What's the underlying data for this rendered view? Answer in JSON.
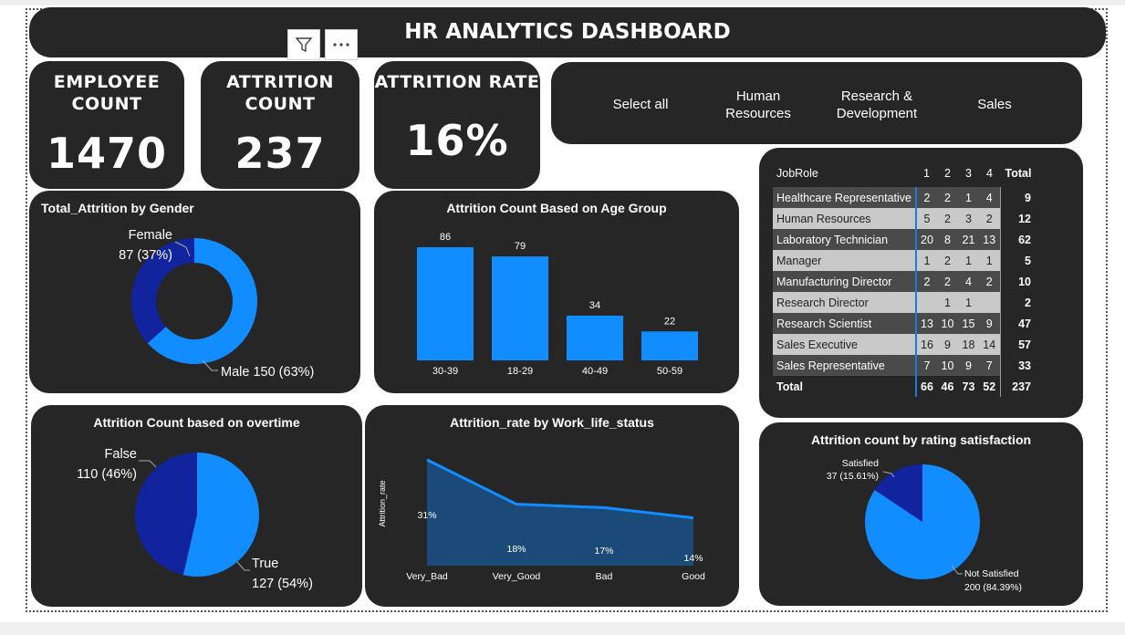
{
  "header": {
    "title": "HR ANALYTICS DASHBOARD"
  },
  "toolbar": {
    "filter_icon": "filter-icon",
    "more_icon": "more-options-icon"
  },
  "kpis": {
    "employee_count": {
      "title_line1": "EMPLOYEE",
      "title_line2": "COUNT",
      "value": "1470"
    },
    "attrition_count": {
      "title_line1": "ATTRITION",
      "title_line2": "COUNT",
      "value": "237"
    },
    "attrition_rate": {
      "title_line1": "ATTRITION RATE",
      "value": "16%"
    }
  },
  "slicer": {
    "items": [
      {
        "line1": "Select all",
        "line2": ""
      },
      {
        "line1": "Human",
        "line2": "Resources"
      },
      {
        "line1": "Research &",
        "line2": "Development"
      },
      {
        "line1": "Sales",
        "line2": ""
      }
    ]
  },
  "colors": {
    "card_bg": "#262626",
    "accent": "#118dff",
    "dark_blue": "#12239e",
    "area_fill": "#1b4a78"
  },
  "chart_data": [
    {
      "id": "gender",
      "type": "pie",
      "title": "Total_Attrition by Gender",
      "donut": true,
      "slices": [
        {
          "label": "Female",
          "value": 87,
          "display": "87 (37%)",
          "color": "#12239e"
        },
        {
          "label": "Male",
          "value": 150,
          "display": "Male 150 (63%)",
          "color": "#118dff"
        }
      ]
    },
    {
      "id": "age",
      "type": "bar",
      "title": "Attrition Count Based on Age Group",
      "categories": [
        "30-39",
        "18-29",
        "40-49",
        "50-59"
      ],
      "values": [
        86,
        79,
        34,
        22
      ],
      "ylim": [
        0,
        86
      ],
      "color": "#118dff"
    },
    {
      "id": "overtime",
      "type": "pie",
      "title": "Attrition Count based on overtime",
      "donut": false,
      "slices": [
        {
          "label": "False",
          "value": 110,
          "display": "110 (46%)",
          "color": "#12239e"
        },
        {
          "label": "True",
          "value": 127,
          "display": "127 (54%)",
          "color": "#118dff"
        }
      ]
    },
    {
      "id": "worklife",
      "type": "area",
      "title": "Attrition_rate by Work_life_status",
      "ylabel": "Attrition_rate",
      "categories": [
        "Very_Bad",
        "Very_Good",
        "Bad",
        "Good"
      ],
      "values": [
        31,
        18,
        17,
        14
      ],
      "labels": [
        "31%",
        "18%",
        "17%",
        "14%"
      ],
      "ylim": [
        0,
        31
      ]
    },
    {
      "id": "satisfaction",
      "type": "pie",
      "title": "Attrition count by rating satisfaction",
      "donut": false,
      "slices": [
        {
          "label": "Satisfied",
          "value": 37,
          "display": "37 (15.61%)",
          "color": "#12239e"
        },
        {
          "label": "Not Satisfied",
          "value": 200,
          "display": "200 (84.39%)",
          "color": "#118dff"
        }
      ]
    },
    {
      "id": "jobrole",
      "type": "table",
      "columns": [
        "JobRole",
        "1",
        "2",
        "3",
        "4",
        "Total"
      ],
      "rows": [
        {
          "role": "Healthcare Representative",
          "v": [
            "2",
            "2",
            "1",
            "4"
          ],
          "total": "9"
        },
        {
          "role": "Human Resources",
          "v": [
            "5",
            "2",
            "3",
            "2"
          ],
          "total": "12"
        },
        {
          "role": "Laboratory Technician",
          "v": [
            "20",
            "8",
            "21",
            "13"
          ],
          "total": "62"
        },
        {
          "role": "Manager",
          "v": [
            "1",
            "2",
            "1",
            "1"
          ],
          "total": "5"
        },
        {
          "role": "Manufacturing Director",
          "v": [
            "2",
            "2",
            "4",
            "2"
          ],
          "total": "10"
        },
        {
          "role": "Research Director",
          "v": [
            "",
            "1",
            "1",
            ""
          ],
          "total": "2"
        },
        {
          "role": "Research Scientist",
          "v": [
            "13",
            "10",
            "15",
            "9"
          ],
          "total": "47"
        },
        {
          "role": "Sales Executive",
          "v": [
            "16",
            "9",
            "18",
            "14"
          ],
          "total": "57"
        },
        {
          "role": "Sales Representative",
          "v": [
            "7",
            "10",
            "9",
            "7"
          ],
          "total": "33"
        }
      ],
      "total_row": {
        "role": "Total",
        "v": [
          "66",
          "46",
          "73",
          "52"
        ],
        "total": "237"
      }
    }
  ]
}
